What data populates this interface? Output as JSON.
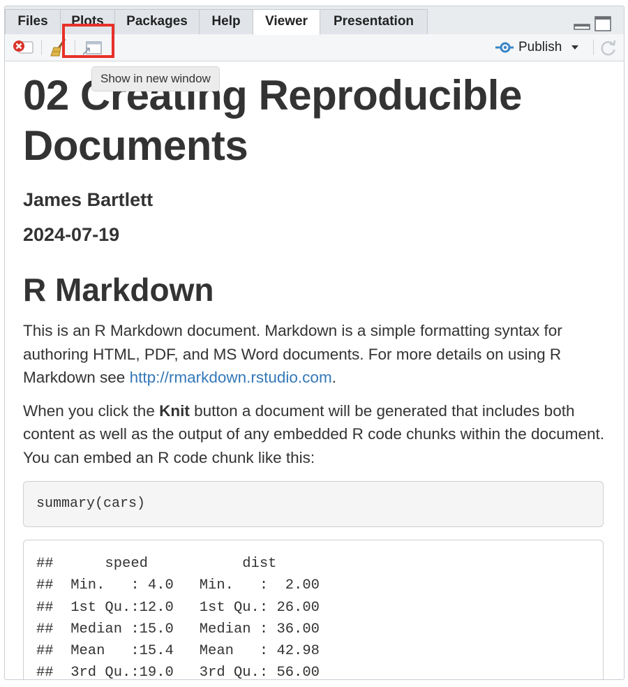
{
  "tabs": [
    {
      "label": "Files"
    },
    {
      "label": "Plots"
    },
    {
      "label": "Packages"
    },
    {
      "label": "Help"
    },
    {
      "label": "Viewer"
    },
    {
      "label": "Presentation"
    }
  ],
  "active_tab": "Viewer",
  "toolbar": {
    "publish_label": "Publish",
    "tooltip": "Show in new window"
  },
  "document": {
    "title": "02 Creating Reproducible Documents",
    "author": "James Bartlett",
    "date": "2024-07-19",
    "section_heading": "R Markdown",
    "para1_text": "This is an R Markdown document. Markdown is a simple formatting syntax for authoring HTML, PDF, and MS Word documents. For more details on using R Markdown see ",
    "para1_link": "http://rmarkdown.rstudio.com",
    "para1_end": ".",
    "para2_before": "When you click the ",
    "para2_bold": "Knit",
    "para2_after": " button a document will be generated that includes both content as well as the output of any embedded R code chunks within the document. You can embed an R code chunk like this:",
    "code": "summary(cars)",
    "output_lines": [
      "##      speed           dist       ",
      "##  Min.   : 4.0   Min.   :  2.00  ",
      "##  1st Qu.:12.0   1st Qu.: 26.00  ",
      "##  Median :15.0   Median : 36.00  ",
      "##  Mean   :15.4   Mean   : 42.98  ",
      "##  3rd Qu.:19.0   3rd Qu.: 56.00  "
    ]
  },
  "colors": {
    "highlight": "#e8302a",
    "link": "#3478b7",
    "publish_icon": "#3a86c8"
  }
}
